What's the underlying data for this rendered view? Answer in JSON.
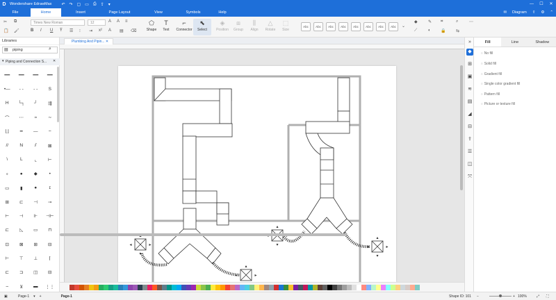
{
  "app": {
    "title": "Wondershare EdrawMax"
  },
  "menu": {
    "tabs": [
      "File",
      "Home",
      "Insert",
      "Page Layout",
      "View",
      "Symbols",
      "Help"
    ],
    "active": "Home",
    "diagram_label": "Diagram"
  },
  "ribbon": {
    "font_family": "Times New Roman",
    "font_size": "12",
    "tools": [
      "Shape",
      "Text",
      "Connector",
      "Select"
    ],
    "arrange": [
      "Position",
      "Group",
      "Align",
      "Rotate",
      "Size"
    ],
    "style_label": "Abc"
  },
  "libraries": {
    "header": "Libraries",
    "search_value": "piping",
    "section": "Piping and Connection S..."
  },
  "document": {
    "tab_label": "Plumbing And Pipin..."
  },
  "right_panel": {
    "tabs": [
      "Fill",
      "Line",
      "Shadow"
    ],
    "fill_options": [
      "No fill",
      "Solid fill",
      "Gradient fill",
      "Single color gradient fill",
      "Pattern fill",
      "Picture or texture fill"
    ]
  },
  "status": {
    "page_tab": "Page-1",
    "page_current": "Page-1",
    "shape_id": "Shape ID: 101",
    "zoom": "100%"
  },
  "palette": [
    "#c0392b",
    "#e74c3c",
    "#d35400",
    "#e67e22",
    "#f1c40f",
    "#f39c12",
    "#27ae60",
    "#2ecc71",
    "#16a085",
    "#1abc9c",
    "#2980b9",
    "#3498db",
    "#8e44ad",
    "#9b59b6",
    "#2c3e50",
    "#7f8c8d",
    "#e91e63",
    "#ff5722",
    "#795548",
    "#607d8b",
    "#009688",
    "#00bcd4",
    "#03a9f4",
    "#3f51b5",
    "#673ab7",
    "#9c27b0",
    "#cddc39",
    "#8bc34a",
    "#4caf50",
    "#ffeb3b",
    "#ffc107",
    "#ff9800",
    "#f44336",
    "#e57373",
    "#ba68c8",
    "#64b5f6",
    "#4dd0e1",
    "#81c784",
    "#fff176",
    "#ffb74d",
    "#a1887f",
    "#90a4ae",
    "#d32f2f",
    "#1976d2",
    "#388e3c",
    "#fbc02d",
    "#7b1fa2",
    "#455a64",
    "#c2185b",
    "#0097a7",
    "#afb42b",
    "#5d4037",
    "#616161",
    "#000000",
    "#424242",
    "#757575",
    "#9e9e9e",
    "#bdbdbd",
    "#e0e0e0",
    "#ffffff",
    "#ff8a80",
    "#82b1ff",
    "#b9f6ca",
    "#ffff8d",
    "#ea80fc",
    "#84ffff",
    "#ccff90",
    "#ffd180",
    "#cfd8dc",
    "#d7ccc8",
    "#ffab91",
    "#80cbc4"
  ]
}
